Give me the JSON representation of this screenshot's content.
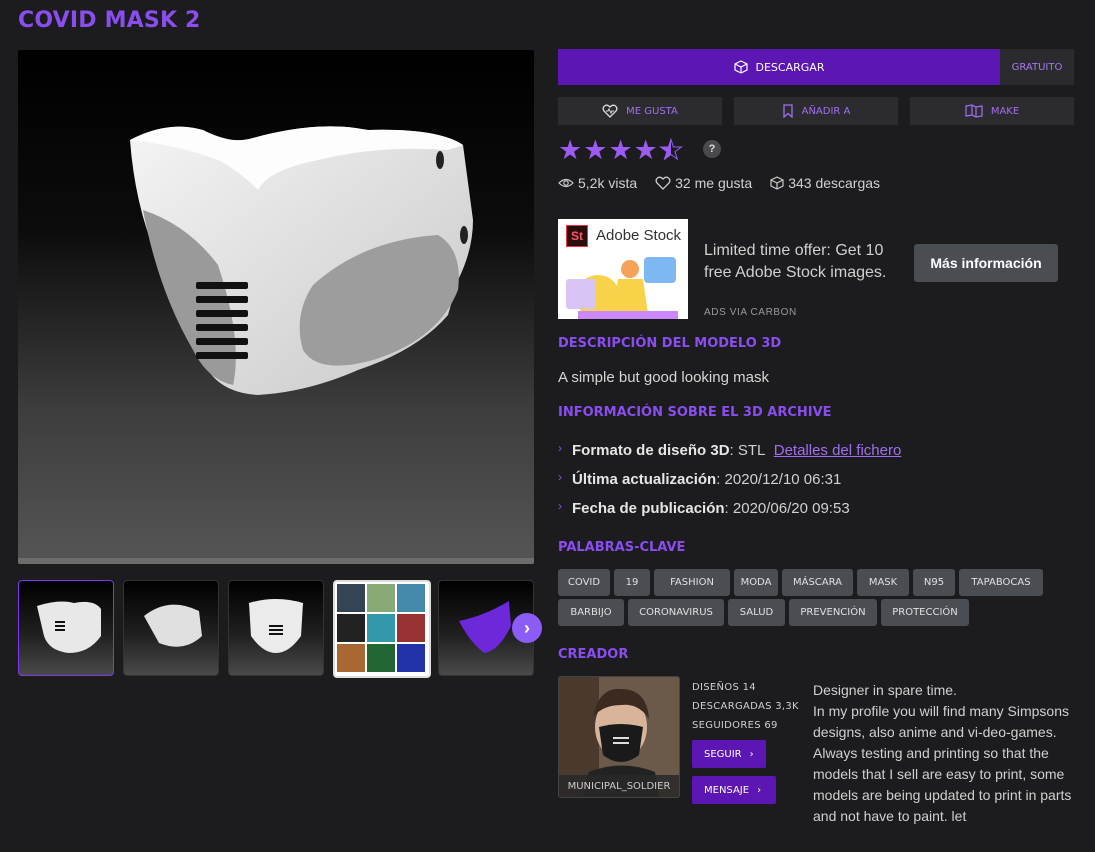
{
  "title": "COVID MASK 2",
  "download": {
    "label": "DESCARGAR",
    "price": "GRATUITO"
  },
  "actions": [
    {
      "label": "ME GUSTA",
      "icon": "heart-icon"
    },
    {
      "label": "AÑADIR A",
      "icon": "bookmark-icon"
    },
    {
      "label": "MAKE",
      "icon": "make-icon"
    }
  ],
  "rating": {
    "value": 4.5,
    "max": 5,
    "help": "?"
  },
  "stats": {
    "views": "5,2k vista",
    "likes": "32 me gusta",
    "downloads": "343 descargas"
  },
  "ad": {
    "brand": "Adobe Stock",
    "brand_badge": "St",
    "text": "Limited time offer: Get 10 free Adobe Stock images.",
    "button": "Más información",
    "via": "ADS VIA CARBON"
  },
  "description": {
    "heading": "DESCRIPCIÓN DEL MODELO 3D",
    "text": "A simple but good looking mask"
  },
  "info": {
    "heading": "INFORMACIÓN SOBRE EL 3D ARCHIVE",
    "format_label": "Formato de diseño 3D",
    "format_value": ": STL",
    "format_link": "Detalles del fichero",
    "updated_label": "Última actualización",
    "updated_value": ": 2020/12/10 06:31",
    "published_label": "Fecha de publicación",
    "published_value": ": 2020/06/20 09:53"
  },
  "keywords": {
    "heading": "PALABRAS-CLAVE",
    "tags": [
      "COVID",
      "19",
      "FASHION",
      "MODA",
      "MÁSCARA",
      "MASK",
      "N95",
      "TAPABOCAS",
      "BARBIJO",
      "CORONAVIRUS",
      "SALUD",
      "PREVENCIÓN",
      "PROTECCIÓN"
    ]
  },
  "creator": {
    "heading": "CREADOR",
    "name": "MUNICIPAL_SOLDIER",
    "designs": "DISEÑOS 14",
    "downloads": "DESCARGADAS 3,3K",
    "followers": "SEGUIDORES 69",
    "follow": "SEGUIR",
    "message": "MENSAJE",
    "bio": "Designer in spare time.\nIn my profile you will find many Simpsons designs, also anime and vi-deo-games.\nAlways testing and printing so that the models that I sell are easy to print, some models are being updated to print in parts and not have to paint. let"
  },
  "colors": {
    "accent": "#8a4df0",
    "button": "#5b16b3",
    "background": "#1c1c1f",
    "tag": "#4a4d52"
  }
}
